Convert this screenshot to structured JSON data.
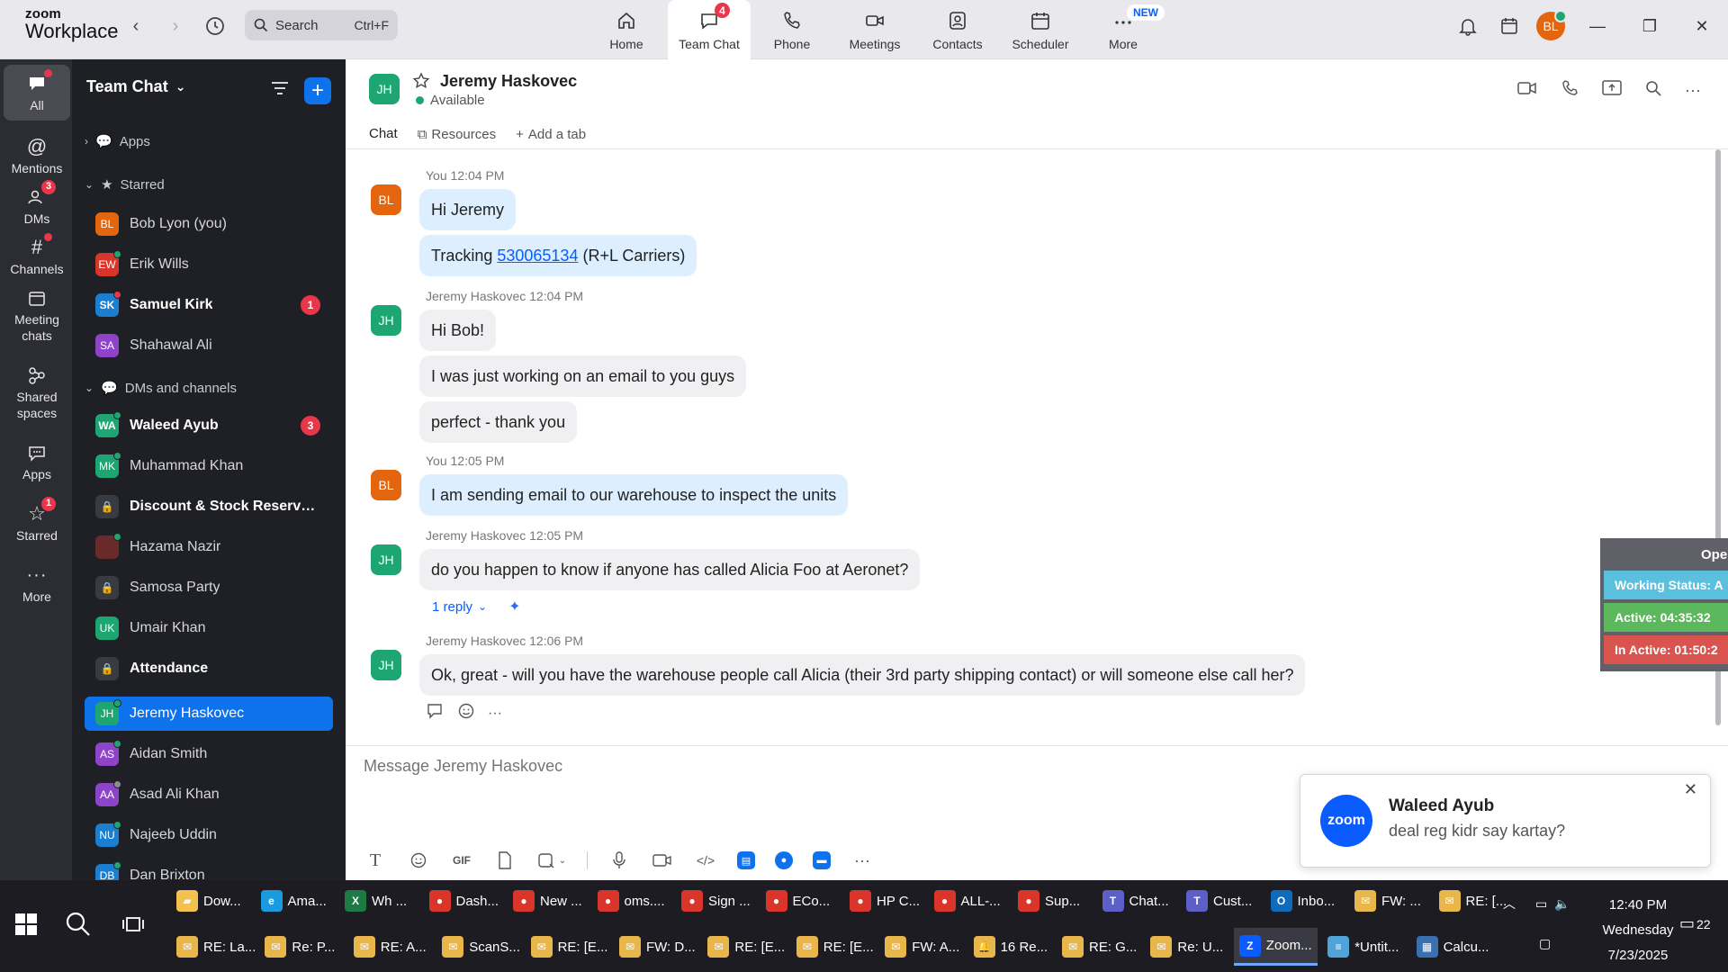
{
  "app": {
    "logo_line1": "zoom",
    "logo_line2": "Workplace"
  },
  "search": {
    "placeholder": "Search",
    "shortcut": "Ctrl+F"
  },
  "nav_tabs": [
    {
      "label": "Home",
      "icon": "home-icon"
    },
    {
      "label": "Team Chat",
      "icon": "chat-icon",
      "badge": "4",
      "active": true
    },
    {
      "label": "Phone",
      "icon": "phone-icon"
    },
    {
      "label": "Meetings",
      "icon": "video-icon"
    },
    {
      "label": "Contacts",
      "icon": "contacts-icon"
    },
    {
      "label": "Scheduler",
      "icon": "calendar-icon"
    },
    {
      "label": "More",
      "icon": "more-icon",
      "new_badge": "NEW"
    }
  ],
  "user": {
    "initials": "BL"
  },
  "rail": [
    {
      "label": "All",
      "icon": "chat-bubble-icon",
      "dot": true,
      "active": true
    },
    {
      "label": "Mentions",
      "icon": "at-icon"
    },
    {
      "label": "DMs",
      "icon": "people-icon",
      "badge": "3"
    },
    {
      "label": "Channels",
      "icon": "hash-icon",
      "dot": true
    },
    {
      "label": "Meeting chats",
      "icon": "calendar-icon"
    },
    {
      "label": "Shared spaces",
      "icon": "share-icon"
    },
    {
      "label": "Apps",
      "icon": "apps-icon"
    },
    {
      "label": "Starred",
      "icon": "star-icon",
      "badge": "1"
    },
    {
      "label": "More",
      "icon": "ellipsis-icon"
    }
  ],
  "sidebar": {
    "title": "Team Chat",
    "sections": {
      "apps": "Apps",
      "starred": "Starred",
      "dms": "DMs and channels"
    },
    "starred": [
      {
        "initials": "BL",
        "name": "Bob Lyon (you)",
        "color": "#e3650e"
      },
      {
        "initials": "EW",
        "name": "Erik Wills",
        "color": "#d9352b"
      },
      {
        "initials": "SK",
        "name": "Samuel Kirk",
        "color": "#1a7fd1",
        "bold": true,
        "count": "1"
      },
      {
        "initials": "SA",
        "name": "Shahawal Ali",
        "color": "#8e44c9"
      }
    ],
    "dms": [
      {
        "initials": "WA",
        "name": "Waleed Ayub",
        "color": "#1ea672",
        "bold": true,
        "count": "3"
      },
      {
        "initials": "MK",
        "name": "Muhammad Khan",
        "color": "#1ea672"
      },
      {
        "lock": true,
        "name": "Discount & Stock Reserva...",
        "bold": true
      },
      {
        "initials": "",
        "name": "Hazama Nazir",
        "color": "#6b2a2a"
      },
      {
        "lock": true,
        "name": "Samosa Party"
      },
      {
        "initials": "UK",
        "name": "Umair Khan",
        "color": "#1ea672"
      },
      {
        "lock": true,
        "name": "Attendance",
        "bold": true
      },
      {
        "initials": "JH",
        "name": "Jeremy Haskovec",
        "color": "#1ea672",
        "selected": true
      },
      {
        "initials": "AS",
        "name": "Aidan Smith",
        "color": "#8e44c9"
      },
      {
        "initials": "AA",
        "name": "Asad Ali Khan",
        "color": "#8e44c9"
      },
      {
        "initials": "NU",
        "name": "Najeeb Uddin",
        "color": "#1a7fd1"
      },
      {
        "initials": "DB",
        "name": "Dan Brixton",
        "color": "#1a7fd1"
      }
    ]
  },
  "chat": {
    "contact_initials": "JH",
    "contact_name": "Jeremy Haskovec",
    "status": "Available",
    "tabs": {
      "chat": "Chat",
      "resources": "Resources",
      "add": "Add a tab"
    }
  },
  "messages": {
    "m1_meta": "You 12:04 PM",
    "m1_text": "Hi Jeremy",
    "m2_prefix": "Tracking ",
    "m2_link": "530065134",
    "m2_suffix": " (R+L Carriers)",
    "m3_meta": "Jeremy Haskovec 12:04 PM",
    "m3_text": "Hi Bob!",
    "m4_text": "I was just working on an email to you guys",
    "m5_text": "perfect - thank you",
    "m6_meta": "You 12:05 PM",
    "m6_text": "I am sending email to our warehouse to inspect the units",
    "m7_meta": "Jeremy Haskovec 12:05 PM",
    "m7_text": "do you happen to know if anyone has called Alicia Foo at Aeronet?",
    "m7_reply": "1 reply",
    "m8_meta": "Jeremy Haskovec 12:06 PM",
    "m8_text": "Ok, great - will you have the warehouse people call Alicia (their 3rd party shipping contact) or will someone else call her?"
  },
  "compose": {
    "placeholder": "Message Jeremy Haskovec"
  },
  "toast": {
    "title": "Waleed Ayub",
    "body": "deal reg kidr say kartay?",
    "logo": "zoom"
  },
  "widget": {
    "header": "Oper",
    "working": "Working Status: A",
    "active": "Active: 04:35:32",
    "inactive": "In Active: 01:50:2",
    "colors": {
      "working": "#5bc0de",
      "active": "#5cb85c",
      "inactive": "#d9534f"
    }
  },
  "taskbar": {
    "row1": [
      {
        "label": "Dow...",
        "icon": "folder-icon",
        "color": "#f2c14e"
      },
      {
        "label": "Ama...",
        "icon": "edge-icon",
        "color": "#1a9be0"
      },
      {
        "label": "Wh ...",
        "icon": "excel-icon",
        "color": "#1e7a45"
      },
      {
        "label": "Dash...",
        "icon": "chrome-icon",
        "color": "#d9352b"
      },
      {
        "label": "New ...",
        "icon": "chrome-icon",
        "color": "#d9352b"
      },
      {
        "label": "oms....",
        "icon": "chrome-icon",
        "color": "#d9352b"
      },
      {
        "label": "Sign ...",
        "icon": "chrome-icon",
        "color": "#d9352b"
      },
      {
        "label": "ECo...",
        "icon": "chrome-icon",
        "color": "#d9352b"
      },
      {
        "label": "HP C...",
        "icon": "chrome-icon",
        "color": "#d9352b"
      },
      {
        "label": "ALL-...",
        "icon": "chrome-icon",
        "color": "#d9352b"
      },
      {
        "label": "Sup...",
        "icon": "chrome-icon",
        "color": "#d9352b"
      },
      {
        "label": "Chat...",
        "icon": "teams-icon",
        "color": "#5b5fc7"
      },
      {
        "label": "Cust...",
        "icon": "teams-icon",
        "color": "#5b5fc7"
      },
      {
        "label": "Inbo...",
        "icon": "outlook-icon",
        "color": "#0f6cbd"
      },
      {
        "label": "FW: ...",
        "icon": "mail-icon",
        "color": "#e8b64a"
      },
      {
        "label": "RE: [...",
        "icon": "mail-icon",
        "color": "#e8b64a"
      }
    ],
    "row2": [
      {
        "label": "RE: La...",
        "icon": "mail-icon",
        "color": "#e8b64a"
      },
      {
        "label": "Re: P...",
        "icon": "mail-icon",
        "color": "#e8b64a"
      },
      {
        "label": "RE: A...",
        "icon": "mail-icon",
        "color": "#e8b64a"
      },
      {
        "label": "ScanS...",
        "icon": "mail-icon",
        "color": "#e8b64a"
      },
      {
        "label": "RE: [E...",
        "icon": "mail-icon",
        "color": "#e8b64a"
      },
      {
        "label": "FW: D...",
        "icon": "mail-icon",
        "color": "#e8b64a"
      },
      {
        "label": "RE: [E...",
        "icon": "mail-icon",
        "color": "#e8b64a"
      },
      {
        "label": "RE: [E...",
        "icon": "mail-icon",
        "color": "#e8b64a"
      },
      {
        "label": "FW: A...",
        "icon": "mail-icon",
        "color": "#e8b64a"
      },
      {
        "label": "16 Re...",
        "icon": "bell-icon",
        "color": "#e8b64a"
      },
      {
        "label": "RE: G...",
        "icon": "mail-icon",
        "color": "#e8b64a"
      },
      {
        "label": "Re: U...",
        "icon": "mail-icon",
        "color": "#e8b64a"
      },
      {
        "label": "Zoom...",
        "icon": "zoom-icon",
        "color": "#0b5cff",
        "active": true
      },
      {
        "label": "*Untit...",
        "icon": "notepad-icon",
        "color": "#4fa3d9"
      },
      {
        "label": "Calcu...",
        "icon": "calculator-icon",
        "color": "#3a6fb0"
      }
    ],
    "clock_time": "12:40 PM",
    "clock_day": "Wednesday",
    "clock_date": "7/23/2025",
    "notif_count": "22"
  }
}
